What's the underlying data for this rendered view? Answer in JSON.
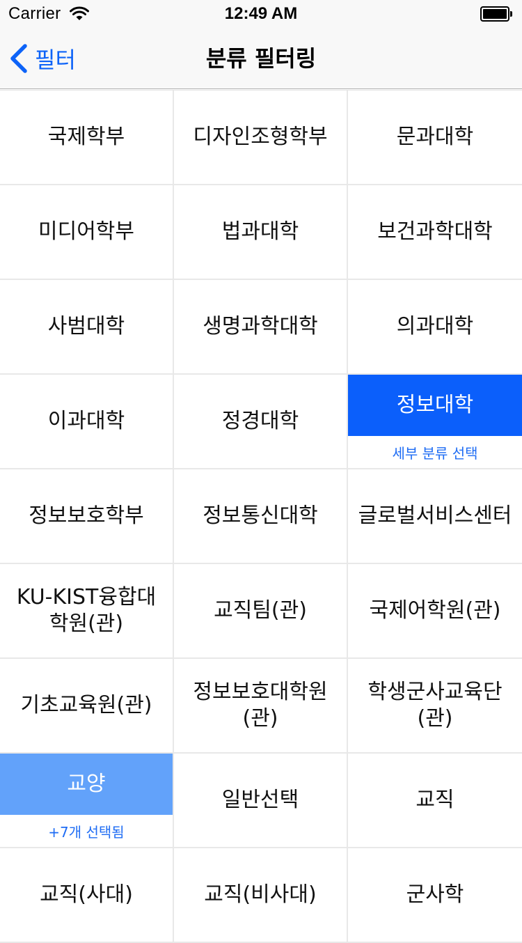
{
  "status": {
    "carrier": "Carrier",
    "time": "12:49 AM"
  },
  "nav": {
    "back_label": "필터",
    "title": "분류 필터링"
  },
  "colors": {
    "accent": "#0b5ffb",
    "accent_light": "#62a2fa",
    "link": "#1e6cf4"
  },
  "categories": [
    {
      "label": "국제학부"
    },
    {
      "label": "디자인조형학부"
    },
    {
      "label": "문과대학"
    },
    {
      "label": "미디어학부"
    },
    {
      "label": "법과대학"
    },
    {
      "label": "보건과학대학"
    },
    {
      "label": "사범대학"
    },
    {
      "label": "생명과학대학"
    },
    {
      "label": "의과대학"
    },
    {
      "label": "이과대학"
    },
    {
      "label": "정경대학"
    },
    {
      "label": "정보대학",
      "selected": true,
      "style": "strong",
      "sub": "세부 분류 선택"
    },
    {
      "label": "정보보호학부"
    },
    {
      "label": "정보통신대학"
    },
    {
      "label": "글로벌서비스센터"
    },
    {
      "label": "KU-KIST융합대학원(관)"
    },
    {
      "label": "교직팀(관)"
    },
    {
      "label": "국제어학원(관)"
    },
    {
      "label": "기초교육원(관)"
    },
    {
      "label": "정보보호대학원(관)"
    },
    {
      "label": "학생군사교육단(관)"
    },
    {
      "label": "교양",
      "selected": true,
      "style": "light",
      "sub": "+7개 선택됨"
    },
    {
      "label": "일반선택"
    },
    {
      "label": "교직"
    },
    {
      "label": "교직(사대)"
    },
    {
      "label": "교직(비사대)"
    },
    {
      "label": "군사학"
    }
  ]
}
